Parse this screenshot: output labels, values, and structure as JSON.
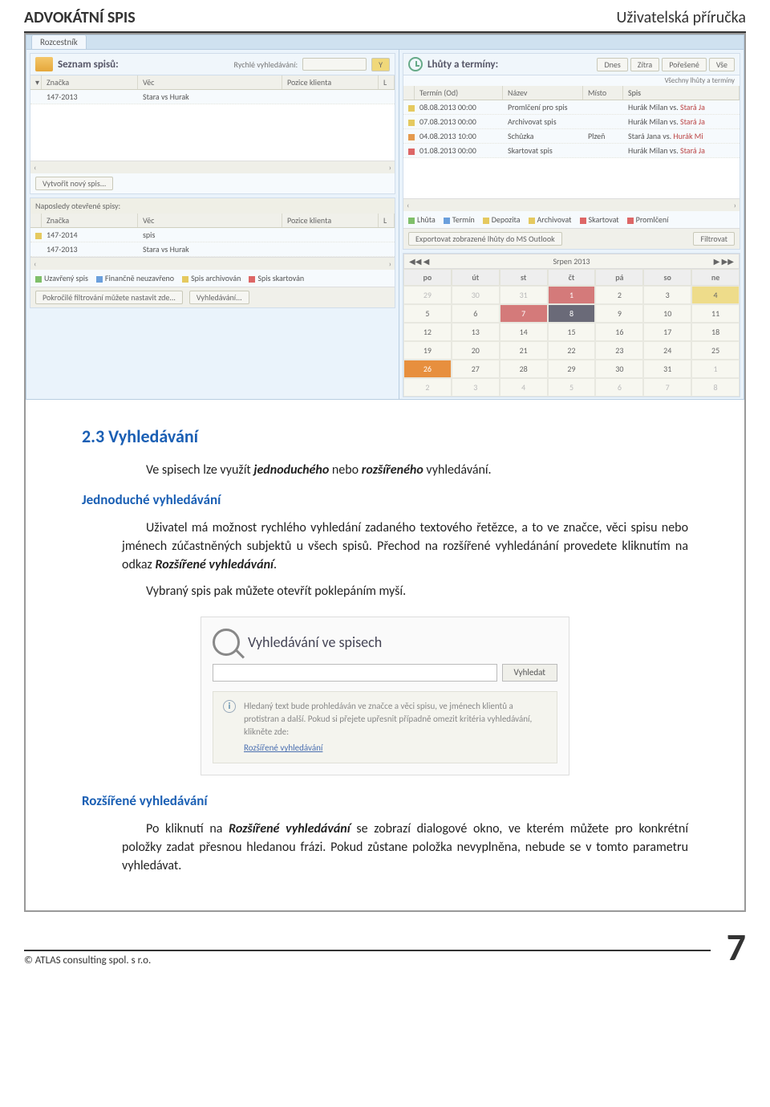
{
  "header": {
    "left": "ADVOKÁTNÍ SPIS",
    "right": "Uživatelská příručka"
  },
  "screenshot1": {
    "tab": "Rozcestník",
    "left_panel": {
      "title": "Seznam spisů:",
      "quick_label": "Rychlé vyhledávání:",
      "filter_btn": "Y",
      "headers": {
        "znacka": "Značka",
        "vec": "Věc",
        "pozice": "Pozice klienta",
        "l": "L"
      },
      "rows": [
        {
          "znacka": "147-2013",
          "vec": "Stara vs Hurak"
        }
      ],
      "create_btn": "Vytvořit nový spis...",
      "recent_label": "Naposledy otevřené spisy:",
      "recent_headers": {
        "znacka": "Značka",
        "vec": "Věc",
        "pozice": "Pozice klienta",
        "l": "L"
      },
      "recent_rows": [
        {
          "marker": "yel",
          "znacka": "147-2014",
          "vec": "spis"
        },
        {
          "marker": "",
          "znacka": "147-2013",
          "vec": "Stara vs Hurak"
        }
      ],
      "legend": [
        {
          "cls": "sq-green",
          "t": "Uzavřený spis"
        },
        {
          "cls": "sq-blue",
          "t": "Finančně neuzavřeno"
        },
        {
          "cls": "sq-yel",
          "t": "Spis archivován"
        },
        {
          "cls": "sq-red",
          "t": "Spis skartován"
        }
      ],
      "foot_left": "Pokročilé filtrování můžete nastavit zde...",
      "foot_right": "Vyhledávání..."
    },
    "right_panel": {
      "title": "Lhůty a termíny:",
      "btns": [
        "Dnes",
        "Zítra",
        "Pořešené",
        "Vše"
      ],
      "all_label": "Všechny lhůty a termíny",
      "headers": {
        "term": "Termín (Od)",
        "nazev": "Název",
        "misto": "Místo",
        "spis": "Spis"
      },
      "rows": [
        {
          "m": "sq-yel",
          "term": "08.08.2013 00:00",
          "nazev": "Promlčení pro spis",
          "misto": "",
          "spis": "Hurák Milan vs. Stará Ja"
        },
        {
          "m": "sq-yel",
          "term": "07.08.2013 00:00",
          "nazev": "Archivovat spis",
          "misto": "",
          "spis": "Hurák Milan vs. Stará Ja"
        },
        {
          "m": "sq-org",
          "term": "04.08.2013 10:00",
          "nazev": "Schůzka",
          "misto": "Plzeň",
          "spis": "Stará Jana vs. Hurák Mi"
        },
        {
          "m": "sq-red",
          "term": "01.08.2013 00:00",
          "nazev": "Skartovat spis",
          "misto": "",
          "spis": "Hurák Milan vs. Stará Ja"
        }
      ],
      "legend": [
        {
          "cls": "sq-green",
          "t": "Lhůta"
        },
        {
          "cls": "sq-blue",
          "t": "Termín"
        },
        {
          "cls": "sq-yel",
          "t": "Depozita"
        },
        {
          "cls": "sq-yel",
          "t": "Archivovat"
        },
        {
          "cls": "sq-red",
          "t": "Skartovat"
        },
        {
          "cls": "sq-red",
          "t": "Promlčení"
        }
      ],
      "export_btn": "Exportovat zobrazené lhůty do MS Outlook",
      "filter_btn": "Filtrovat",
      "calendar": {
        "title": "Srpen 2013",
        "days": [
          "po",
          "út",
          "st",
          "čt",
          "pá",
          "so",
          "ne"
        ],
        "cells": [
          {
            "v": "29",
            "cls": "dim"
          },
          {
            "v": "30",
            "cls": "dim"
          },
          {
            "v": "31",
            "cls": "dim"
          },
          {
            "v": "1",
            "cls": "hl-red"
          },
          {
            "v": "2"
          },
          {
            "v": "3"
          },
          {
            "v": "4",
            "cls": "hl-yel"
          },
          {
            "v": "5"
          },
          {
            "v": "6"
          },
          {
            "v": "7",
            "cls": "hl-red"
          },
          {
            "v": "8",
            "cls": "hl-dark"
          },
          {
            "v": "9"
          },
          {
            "v": "10"
          },
          {
            "v": "11"
          },
          {
            "v": "12"
          },
          {
            "v": "13"
          },
          {
            "v": "14"
          },
          {
            "v": "15"
          },
          {
            "v": "16"
          },
          {
            "v": "17"
          },
          {
            "v": "18"
          },
          {
            "v": "19"
          },
          {
            "v": "20"
          },
          {
            "v": "21"
          },
          {
            "v": "22"
          },
          {
            "v": "23"
          },
          {
            "v": "24"
          },
          {
            "v": "25"
          },
          {
            "v": "26",
            "cls": "hl-or"
          },
          {
            "v": "27"
          },
          {
            "v": "28"
          },
          {
            "v": "29"
          },
          {
            "v": "30"
          },
          {
            "v": "31"
          },
          {
            "v": "1",
            "cls": "dim"
          },
          {
            "v": "2",
            "cls": "dim"
          },
          {
            "v": "3",
            "cls": "dim"
          },
          {
            "v": "4",
            "cls": "dim"
          },
          {
            "v": "5",
            "cls": "dim"
          },
          {
            "v": "6",
            "cls": "dim"
          },
          {
            "v": "7",
            "cls": "dim"
          },
          {
            "v": "8",
            "cls": "dim"
          }
        ]
      }
    }
  },
  "text": {
    "h2": "2.3 Vyhledávání",
    "p1a": "Ve spisech lze využít ",
    "p1b": "jednoduchého",
    "p1c": " nebo ",
    "p1d": "rozšířeného",
    "p1e": " vyhledávání.",
    "h3a": "Jednoduché vyhledávání",
    "p2a": "Uživatel má možnost rychlého vyhledání zadaného textového řetězce, a to ve značce, věci spisu nebo jménech zúčastněných subjektů u všech spisů. Přechod na rozšířené vyhledánání provedete kliknutím na odkaz ",
    "p2b": "Rozšířené vyhledávání",
    "p2c": ".",
    "p3": "Vybraný spis pak můžete otevřít poklepáním myší.",
    "h3b": "Rozšířené vyhledávání",
    "p4a": "Po kliknutí na ",
    "p4b": "Rozšířené vyhledávání",
    "p4c": " se zobrazí dialogové okno, ve kterém můžete pro konkrétní položky zadat přesnou hledanou frázi. Pokud zůstane položka nevyplněna, nebude se v tomto parametru vyhledávat."
  },
  "screenshot2": {
    "title": "Vyhledávání ve spisech",
    "btn": "Vyhledat",
    "info": "Hledaný text bude prohledáván ve značce a věci spisu, ve jménech klientů a protistran a další. Pokud si přejete upřesnit případně omezit kritéria vyhledávání, klikněte zde:",
    "link": "Rozšířené vyhledávání"
  },
  "footer": {
    "copy": "© ATLAS consulting spol. s r.o.",
    "page": "7"
  }
}
